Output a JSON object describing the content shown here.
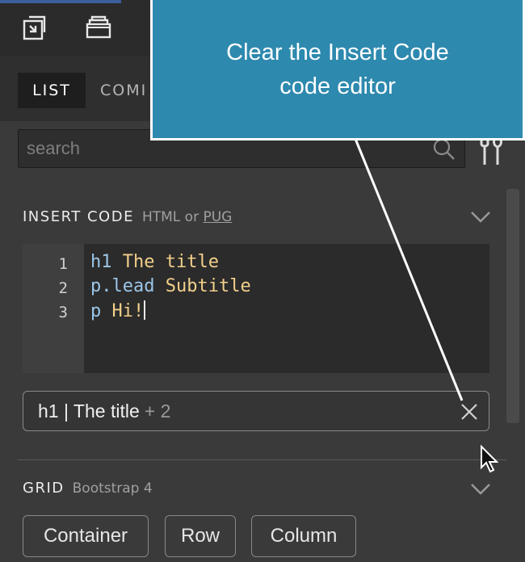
{
  "toolbar": {
    "icons": [
      "import-icon",
      "layers-icon"
    ]
  },
  "tabs": [
    {
      "label": "LIST",
      "active": true
    },
    {
      "label": "COMI",
      "active": false
    }
  ],
  "search": {
    "placeholder": "search",
    "value": ""
  },
  "insert_code": {
    "title": "INSERT CODE",
    "subtitle_prefix": "HTML or ",
    "subtitle_link": "PUG",
    "lines": [
      {
        "number": "1",
        "tag": "h1",
        "text": " The title"
      },
      {
        "number": "2",
        "tag": "p.lead",
        "text": " Subtitle"
      },
      {
        "number": "3",
        "tag": "p",
        "text": " Hi!"
      }
    ],
    "result_main": "h1 | The title",
    "result_extra": "+ 2"
  },
  "grid": {
    "title": "GRID",
    "subtitle": "Bootstrap 4",
    "chips": [
      "Container",
      "Row",
      "Column"
    ]
  },
  "tooltip": {
    "text": "Clear the Insert Code code editor"
  },
  "colors": {
    "tooltip_bg": "#2e89ae",
    "panel_bg": "#3a3a3a",
    "code_tag": "#9cc6e8",
    "code_text": "#f2d08a"
  }
}
